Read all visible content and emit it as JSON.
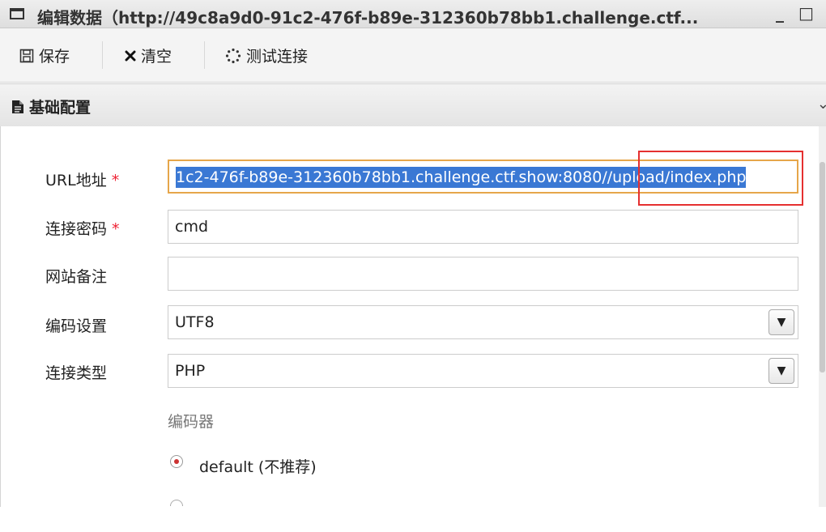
{
  "window": {
    "title": "编辑数据（http://49c8a9d0-91c2-476f-b89e-312360b78bb1.challenge.ctf...",
    "minimize_label": "_",
    "maximize_label": "□"
  },
  "toolbar": {
    "save_label": "保存",
    "clear_label": "清空",
    "test_label": "测试连接"
  },
  "section": {
    "title": "基础配置"
  },
  "form": {
    "url_label": "URL地址",
    "url_required": "*",
    "url_value": "1c2-476f-b89e-312360b78bb1.challenge.ctf.show:8080//upload/index.php",
    "password_label": "连接密码",
    "password_required": "*",
    "password_value": "cmd",
    "note_label": "网站备注",
    "note_value": "",
    "encoding_label": "编码设置",
    "encoding_value": "UTF8",
    "type_label": "连接类型",
    "type_value": "PHP",
    "encoder_label": "编码器",
    "encoder_option_default": "default (不推荐)"
  },
  "icons": {
    "window": "window-icon",
    "save": "save-icon",
    "clear": "close-icon",
    "test": "spinner-icon",
    "section": "document-icon",
    "collapse": "chevron-down-icon"
  },
  "colors": {
    "selection": "#3a78d4",
    "highlight_box": "#e53030",
    "active_border": "#e6a64a",
    "required": "#ee2233"
  }
}
